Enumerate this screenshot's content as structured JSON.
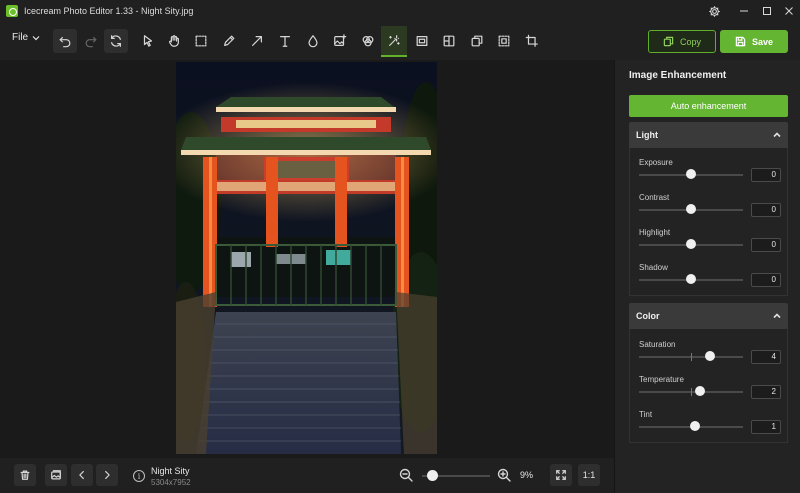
{
  "window": {
    "title": "Icecream Photo Editor 1.33 - Night Sity.jpg",
    "settings_icon": "gear-icon",
    "minimize_icon": "minimize-icon",
    "maximize_icon": "maximize-icon",
    "close_icon": "close-icon"
  },
  "toolbar": {
    "file_label": "File",
    "tools": [
      "undo",
      "redo",
      "reset",
      "select-pointer",
      "hand",
      "marquee-select",
      "brush",
      "arrow",
      "text",
      "drop",
      "image-insert",
      "color-filter",
      "auto-enhance",
      "frame",
      "split",
      "layers",
      "resize",
      "crop"
    ],
    "active_tool": "auto-enhance",
    "copy_label": "Copy",
    "save_label": "Save"
  },
  "footer": {
    "file_name": "Night Sity",
    "file_dimensions": "5304x7952",
    "zoom_value": "9%",
    "zoom_level": 0.05,
    "actual_size_label": "1:1"
  },
  "panel": {
    "title": "Image Enhancement",
    "auto_button": "Auto enhancement",
    "sections": [
      {
        "name": "Light",
        "sliders": [
          {
            "label": "Exposure",
            "value": "0",
            "level": 0.5
          },
          {
            "label": "Contrast",
            "value": "0",
            "level": 0.5
          },
          {
            "label": "Highlight",
            "value": "0",
            "level": 0.5
          },
          {
            "label": "Shadow",
            "value": "0",
            "level": 0.5
          }
        ]
      },
      {
        "name": "Color",
        "sliders": [
          {
            "label": "Saturation",
            "value": "4",
            "level": 0.68
          },
          {
            "label": "Temperature",
            "value": "2",
            "level": 0.59
          },
          {
            "label": "Tint",
            "value": "1",
            "level": 0.54
          }
        ]
      }
    ]
  },
  "colors": {
    "accent": "#64b531",
    "background": "#1c1c1c",
    "panel": "#232323",
    "section_header": "#3a3a3a"
  }
}
